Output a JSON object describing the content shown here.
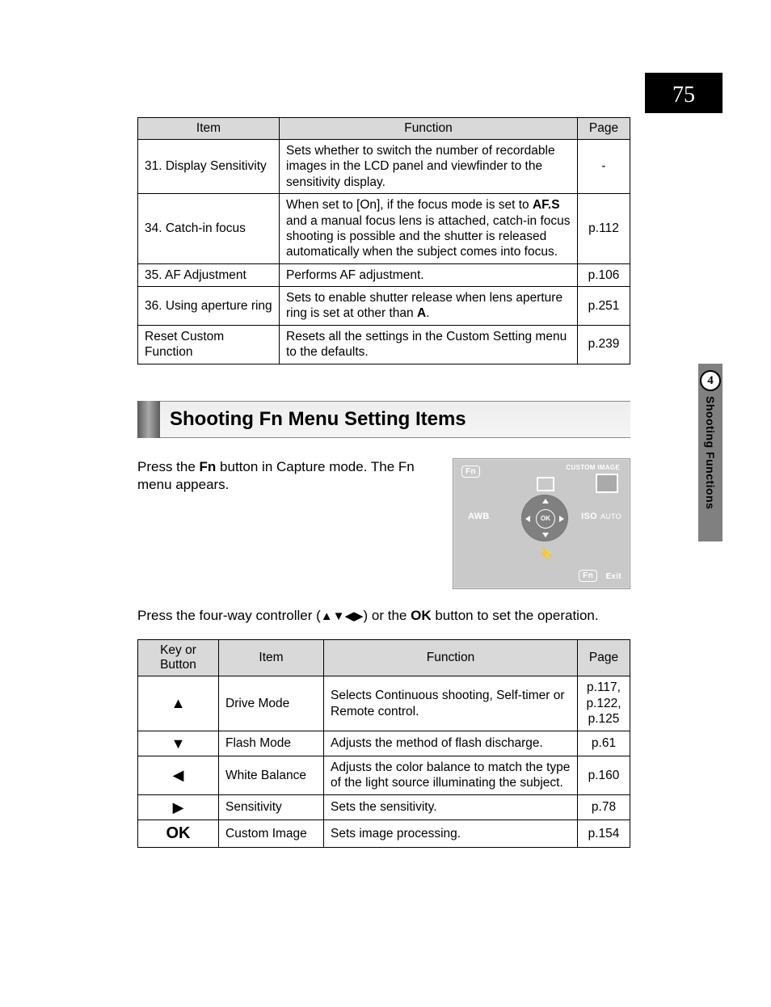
{
  "page_number": "75",
  "section_number": "4",
  "section_title": "Shooting Functions",
  "table1": {
    "headers": {
      "item": "Item",
      "function": "Function",
      "page": "Page"
    },
    "rows": [
      {
        "item": "31. Display Sensitivity",
        "function": "Sets whether to switch the number of recordable images in the LCD panel and viewfinder to the sensitivity display.",
        "page": "-"
      },
      {
        "item": "34. Catch-in focus",
        "function_pre": "When set to [On], if the focus mode is set to ",
        "function_bold": "AF.S",
        "function_post": " and a manual focus lens is attached, catch-in focus shooting is possible and the shutter is released automatically when the subject comes into focus.",
        "page": "p.112"
      },
      {
        "item": "35. AF Adjustment",
        "function": "Performs AF adjustment.",
        "page": "p.106"
      },
      {
        "item": "36. Using aperture ring",
        "function_pre": "Sets to enable shutter release when lens aperture ring is set at other than ",
        "function_bold": "A",
        "function_post": ".",
        "page": "p.251"
      },
      {
        "item": "Reset Custom Function",
        "function": "Resets all the settings in the Custom Setting menu to the defaults.",
        "page": "p.239"
      }
    ]
  },
  "heading": "Shooting Fn Menu Setting Items",
  "intro1_pre": "Press the ",
  "intro1_bold": "Fn",
  "intro1_post": " button in Capture mode. The Fn menu appears.",
  "illus": {
    "fn": "Fn",
    "custom": "CUSTOM IMAGE",
    "awb": "AWB",
    "ok": "OK",
    "iso": "ISO",
    "auto": "AUTO",
    "exit_fn": "Fn",
    "exit": "Exit"
  },
  "intro2_pre": "Press the four-way controller (",
  "intro2_arrows": "▲▼◀▶",
  "intro2_mid": ") or the ",
  "intro2_bold": "OK",
  "intro2_post": " button to set the operation.",
  "table2": {
    "headers": {
      "key": "Key or Button",
      "item": "Item",
      "function": "Function",
      "page": "Page"
    },
    "rows": [
      {
        "key": "▲",
        "item": "Drive Mode",
        "function": "Selects Continuous shooting, Self-timer or Remote control.",
        "page": "p.117, p.122, p.125"
      },
      {
        "key": "▼",
        "item": "Flash Mode",
        "function": "Adjusts the method of flash discharge.",
        "page": "p.61"
      },
      {
        "key": "◀",
        "item": "White Balance",
        "function": "Adjusts the color balance to match the type of the light source illuminating the subject.",
        "page": "p.160"
      },
      {
        "key": "▶",
        "item": "Sensitivity",
        "function": "Sets the sensitivity.",
        "page": "p.78"
      },
      {
        "key": "OK",
        "item": "Custom Image",
        "function": "Sets image processing.",
        "page": "p.154"
      }
    ]
  }
}
